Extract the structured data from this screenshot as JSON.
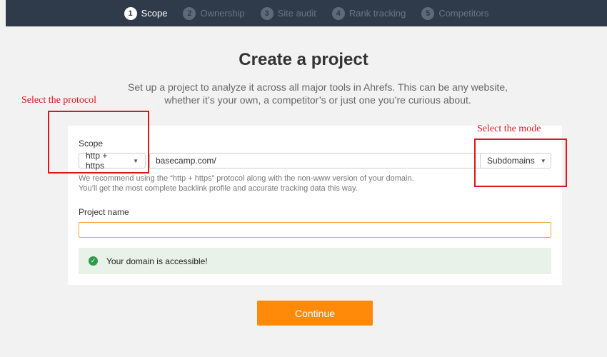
{
  "steps": [
    {
      "num": "1",
      "label": "Scope"
    },
    {
      "num": "2",
      "label": "Ownership"
    },
    {
      "num": "3",
      "label": "Site audit"
    },
    {
      "num": "4",
      "label": "Rank tracking"
    },
    {
      "num": "5",
      "label": "Competitors"
    }
  ],
  "page": {
    "title": "Create a project",
    "subtitle_line1": "Set up a project to analyze it across all major tools in Ahrefs. This can be any website,",
    "subtitle_line2": "whether it’s your own, a competitor’s or just one you’re curious about."
  },
  "form": {
    "scope_label": "Scope",
    "protocol_value": "http + https",
    "domain_value": "basecamp.com/",
    "mode_value": "Subdomains",
    "hint_line1": "We recommend using the “http + https” protocol along with the non-www version of your domain.",
    "hint_line2": "You’ll get the most complete backlink profile and accurate tracking data this way.",
    "project_name_label": "Project name",
    "project_name_value": "",
    "notice_text": "Your domain is accessible!",
    "continue_label": "Continue"
  },
  "annotations": {
    "protocol": "Select the protocol",
    "mode": "Select the mode"
  },
  "colors": {
    "topbar": "#2f3a4a",
    "accent_orange": "#ff8a0a",
    "annotation_red": "#e0141e",
    "success_green": "#2c9b47"
  }
}
